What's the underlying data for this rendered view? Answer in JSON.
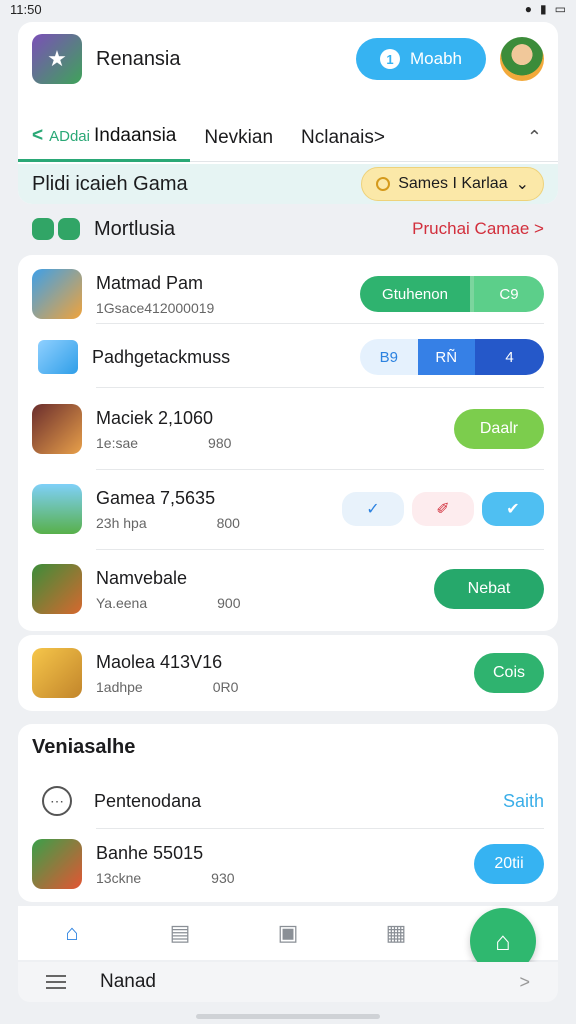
{
  "status": {
    "time": "11:50",
    "icons": [
      "wifi-icon",
      "signal-icon",
      "battery-icon"
    ]
  },
  "header": {
    "title": "Renansia",
    "action_label": "Moabh",
    "action_icon": "1"
  },
  "tabs": [
    {
      "prefix": "ADdai",
      "label": "Indaansia",
      "active": true
    },
    {
      "label": "Nevkian"
    },
    {
      "label": "Nclanais>"
    }
  ],
  "filter": {
    "title": "Plidi icaieh Gama",
    "pill_label": "Sames I Karlaa"
  },
  "section": {
    "title": "Mortlusia",
    "link": "Pruchai Camae  >"
  },
  "rows": [
    {
      "name": "Matmad Pam",
      "sub1": "1Gsace412000019",
      "sub2": "",
      "seg": [
        "Gtuhenon",
        "",
        "C9"
      ]
    },
    {
      "name": "Padhgetackmuss",
      "seg": [
        "B9",
        "RÑ",
        "4"
      ]
    },
    {
      "name": "Maciek 2,1060",
      "sub1": "1e:sae",
      "sub2": "980",
      "button": "Daalr"
    },
    {
      "name": "Gamea 7,5635",
      "sub1": "23h hpa",
      "sub2": "800",
      "minis": [
        "✓",
        "✐",
        "✔"
      ]
    },
    {
      "name": "Namvebale",
      "sub1": "Ya.eena",
      "sub2": "900",
      "button": "Nebat"
    }
  ],
  "single_row": {
    "name": "Maolea 413V16",
    "sub1": "1adhpe",
    "sub2": "0R0",
    "button": "Cois"
  },
  "bottom": {
    "title": "Veniasalhe",
    "item_label": "Pentenodana",
    "item_link": "Saith",
    "game_name": "Banhe 55015",
    "game_sub1": "13ckne",
    "game_sub2": "930",
    "game_button": "20tii"
  },
  "nav": {
    "items": [
      "home-icon",
      "cards-icon",
      "bag-icon",
      "book-icon"
    ],
    "fab_icon": "home-outline-icon"
  },
  "footer": {
    "label": "Nanad"
  },
  "colors": {
    "accent_blue": "#36b3f2",
    "accent_green": "#2fb86f",
    "link_red": "#d22f3c"
  }
}
